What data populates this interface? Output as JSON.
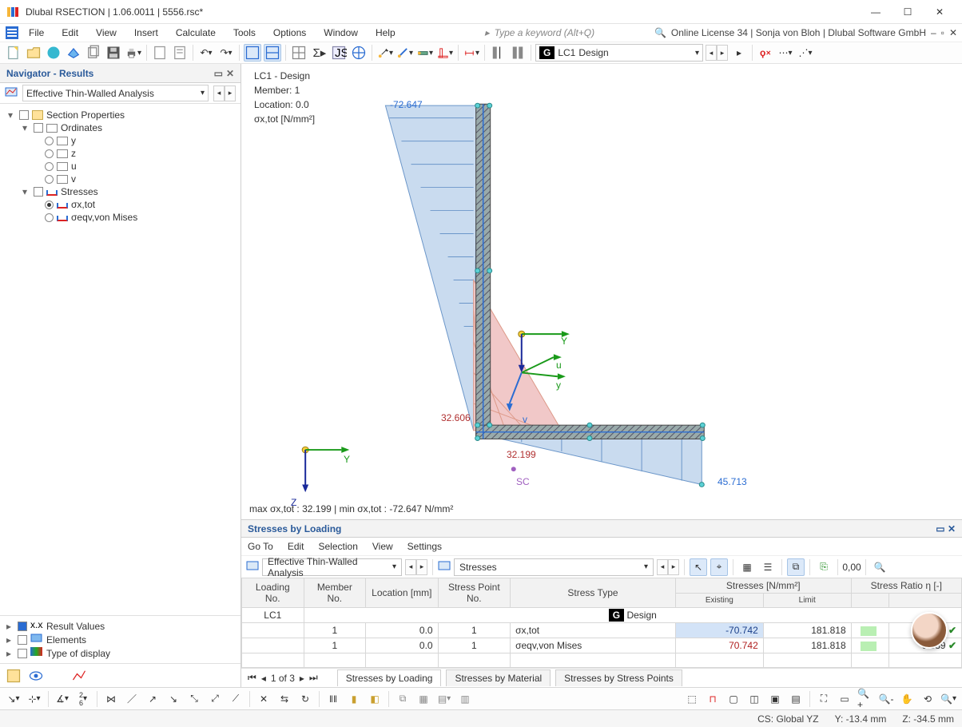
{
  "window": {
    "title": "Dlubal RSECTION | 1.06.0011 | 5556.rsc*"
  },
  "menu": {
    "items": [
      "File",
      "Edit",
      "View",
      "Insert",
      "Calculate",
      "Tools",
      "Options",
      "Window",
      "Help"
    ],
    "search_placeholder": "Type a keyword (Alt+Q)",
    "license": "Online License 34 | Sonja von Bloh | Dlubal Software GmbH"
  },
  "toolbar": {
    "lc_badge": "G",
    "lc_code": "LC1",
    "lc_name": "Design"
  },
  "navigator": {
    "title": "Navigator - Results",
    "analysis": "Effective Thin-Walled Analysis",
    "tree": {
      "root": "Section Properties",
      "ordinates": {
        "label": "Ordinates",
        "items": [
          "y",
          "z",
          "u",
          "v"
        ]
      },
      "stresses": {
        "label": "Stresses",
        "items": [
          "σx,tot",
          "σeqv,von Mises"
        ],
        "selected": 0
      }
    },
    "bottom": {
      "result_values": "Result Values",
      "elements": "Elements",
      "type_of_display": "Type of display"
    }
  },
  "viewport": {
    "header": {
      "lc": "LC1 - Design",
      "member": "Member: 1",
      "location": "Location: 0.0",
      "quantity": "σx,tot [N/mm²]"
    },
    "labels": {
      "top_value": "-72.647",
      "mid_value": "32.606",
      "bottom_value1": "32.199",
      "bottom_value2": "45.713",
      "sc": "SC",
      "Y_main": "Y",
      "Z_main": "Z",
      "y_local": "y",
      "u_local": "u",
      "v_local": "v"
    },
    "footer": "max σx,tot : 32.199 | min σx,tot : -72.647 N/mm²"
  },
  "panel": {
    "title": "Stresses by Loading",
    "menu": [
      "Go To",
      "Edit",
      "Selection",
      "View",
      "Settings"
    ],
    "combo1": "Effective Thin-Walled Analysis",
    "combo2": "Stresses",
    "headers": {
      "loading_no": "Loading No.",
      "member_no": "Member No.",
      "location": "Location [mm]",
      "stress_point_no": "Stress Point No.",
      "stress_type": "Stress Type",
      "stresses_group": "Stresses [N/mm²]",
      "existing": "Existing",
      "limit": "Limit",
      "ratio_group": "Stress Ratio η [-]"
    },
    "rows": {
      "lc_row": {
        "no": "LC1",
        "badge": "G",
        "name": "Design"
      },
      "r1": {
        "member": "1",
        "location": "0.0",
        "sp": "1",
        "type": "σx,tot",
        "existing": "-70.742",
        "limit": "181.818",
        "ratio": "0.389"
      },
      "r2": {
        "member": "1",
        "location": "0.0",
        "sp": "1",
        "type": "σeqv,von Mises",
        "existing": "70.742",
        "limit": "181.818",
        "ratio": "0.389"
      }
    },
    "pager": {
      "pos": "1 of 3"
    },
    "tabs": [
      "Stresses by Loading",
      "Stresses by Material",
      "Stresses by Stress Points"
    ]
  },
  "status": {
    "cs": "CS: Global YZ",
    "y": "Y: -13.4 mm",
    "z": "Z: -34.5 mm"
  }
}
